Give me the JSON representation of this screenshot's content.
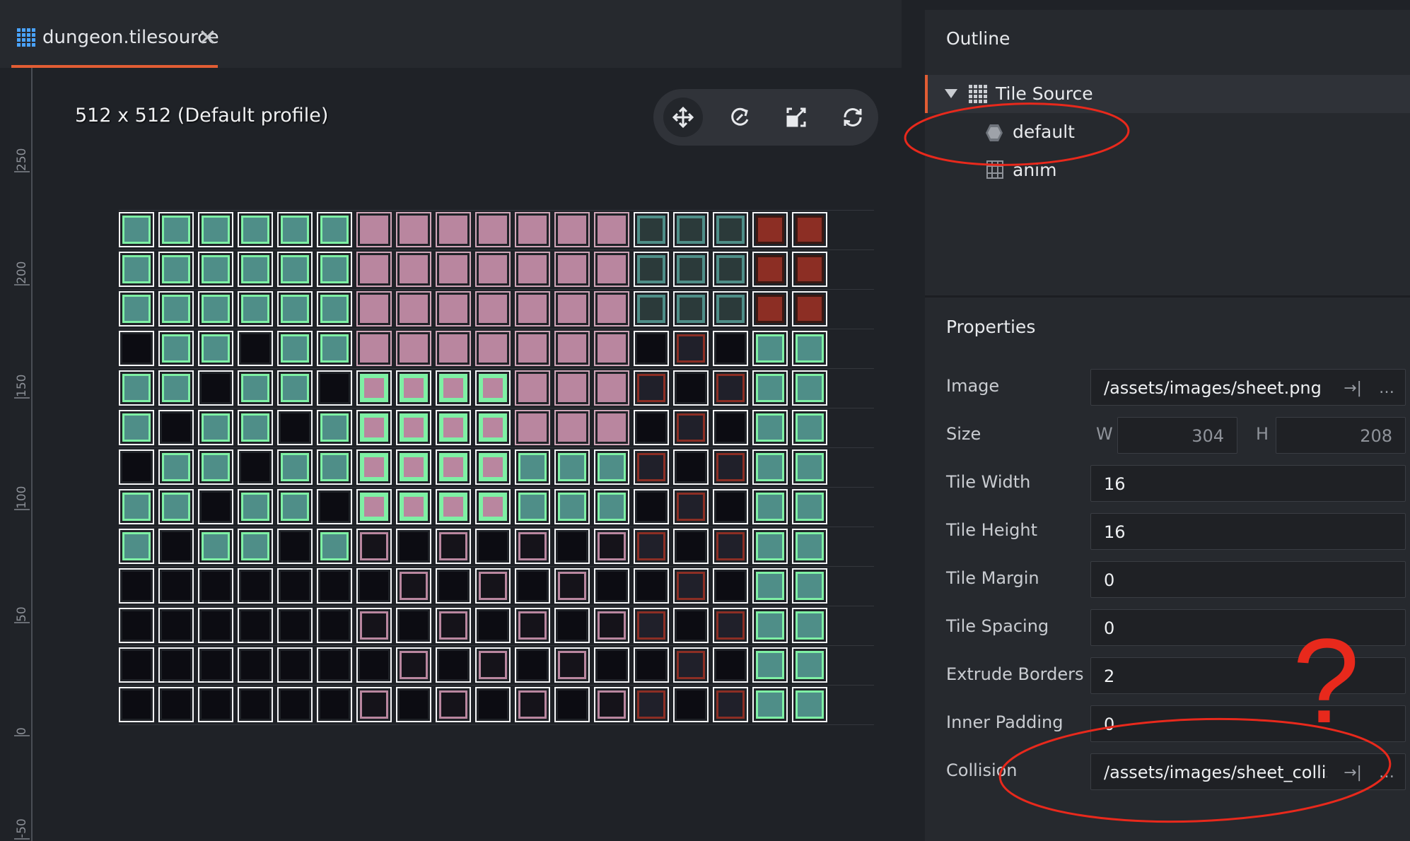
{
  "tab": {
    "filename": "dungeon.tilesource",
    "close_glyph": "✕",
    "icon": "tilesource-grid-icon"
  },
  "ruler": {
    "labels": [
      "250",
      "200",
      "150",
      "100",
      "50",
      "0",
      "-50"
    ]
  },
  "canvas": {
    "profile_label": "512 x 512 (Default profile)"
  },
  "toolbar": {
    "tools": [
      "move-tool-icon",
      "rotate-tool-icon",
      "scale-tool-icon",
      "reload-icon"
    ],
    "active": "move-tool-icon"
  },
  "outline": {
    "title": "Outline",
    "root": {
      "label": "Tile Source",
      "icon": "tilesource-grid-icon",
      "expanded": true
    },
    "children": [
      {
        "label": "default",
        "icon": "collision-group-icon"
      },
      {
        "label": "anim",
        "icon": "animation-icon"
      }
    ]
  },
  "properties": {
    "title": "Properties",
    "image": {
      "label": "Image",
      "value": "/assets/images/sheet.png"
    },
    "size": {
      "label": "Size",
      "w_label": "W",
      "w_value": "304",
      "h_label": "H",
      "h_value": "208"
    },
    "tile_width": {
      "label": "Tile Width",
      "value": "16"
    },
    "tile_height": {
      "label": "Tile Height",
      "value": "16"
    },
    "tile_margin": {
      "label": "Tile Margin",
      "value": "0"
    },
    "tile_spacing": {
      "label": "Tile Spacing",
      "value": "0"
    },
    "extrude_borders": {
      "label": "Extrude Borders",
      "value": "2"
    },
    "inner_padding": {
      "label": "Inner Padding",
      "value": "0"
    },
    "collision": {
      "label": "Collision",
      "value": "/assets/images/sheet_collisi"
    }
  },
  "annotation": {
    "question_mark": "?",
    "color": "#e8291c"
  },
  "colors": {
    "accent": "#e25d34",
    "tile_teal": "#4f8e88",
    "tile_pink": "#b9869f",
    "tile_green": "#7ef0a4",
    "tile_red": "#8c2e24"
  }
}
